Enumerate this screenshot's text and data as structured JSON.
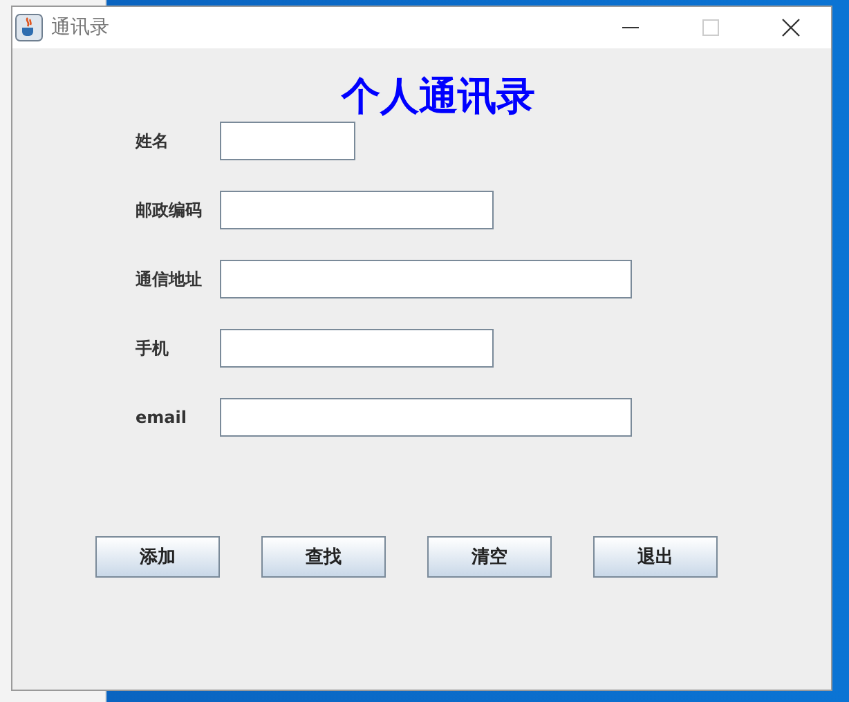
{
  "window": {
    "title": "通讯录"
  },
  "heading": "个人通讯录",
  "fields": [
    {
      "label": "姓名",
      "kind": "short"
    },
    {
      "label": "邮政编码",
      "kind": "medium"
    },
    {
      "label": "通信地址",
      "kind": "long"
    },
    {
      "label": "手机",
      "kind": "medium"
    },
    {
      "label": "email",
      "kind": "long"
    }
  ],
  "buttons": [
    "添加",
    "查找",
    "清空",
    "退出"
  ]
}
